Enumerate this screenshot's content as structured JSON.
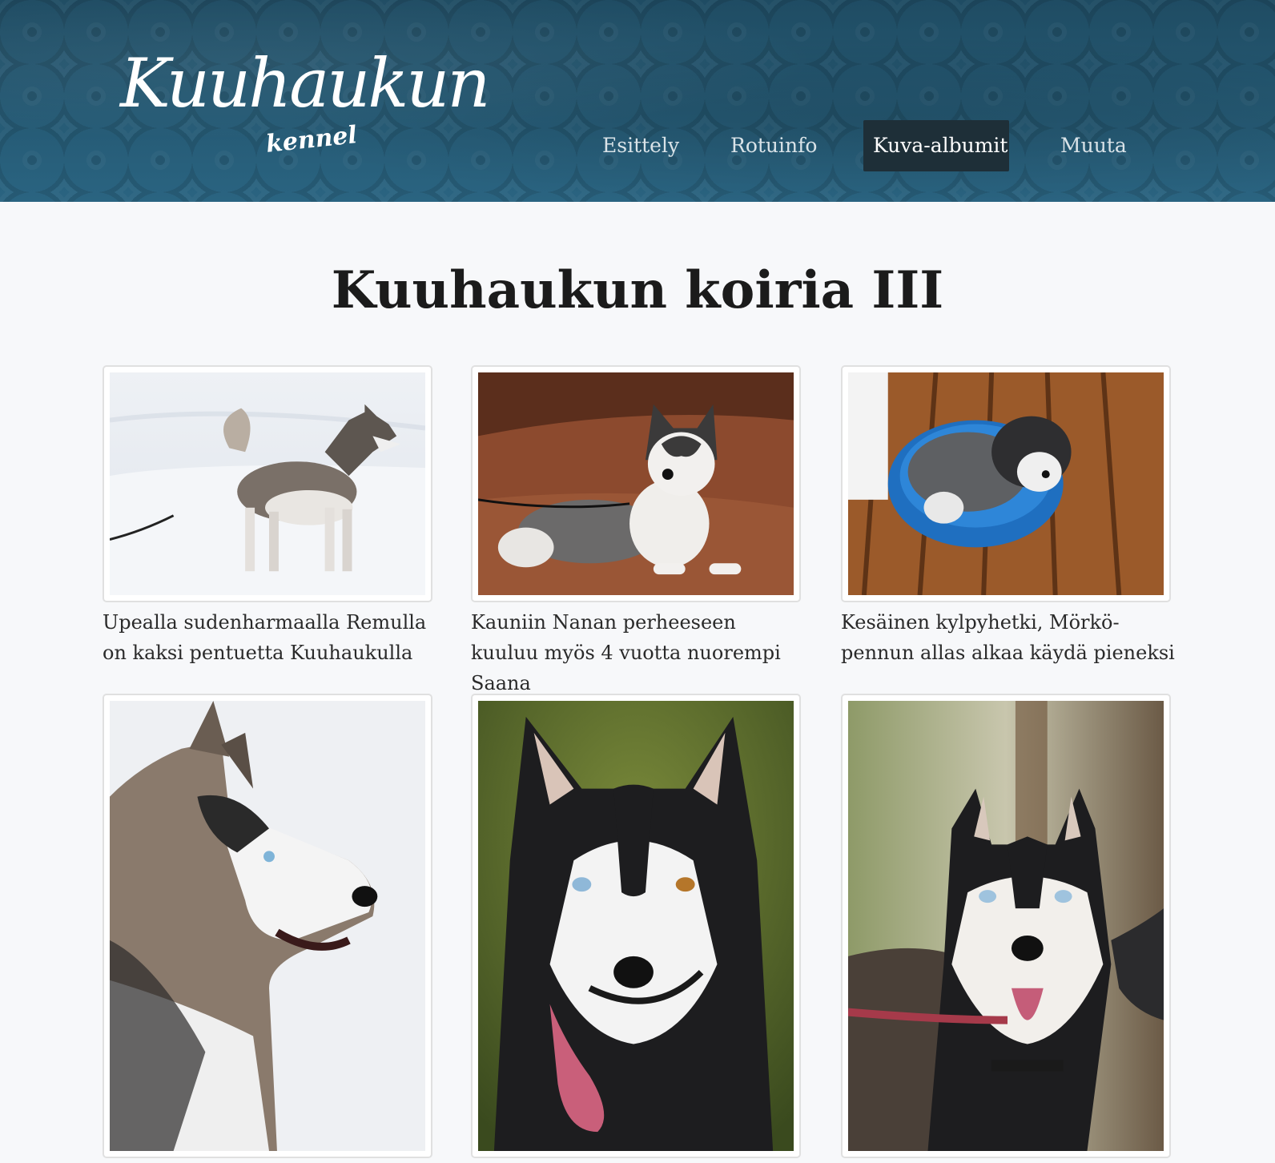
{
  "brand": {
    "logo_main": "Kuuhaukun",
    "logo_sub": "kennel"
  },
  "nav": {
    "items": [
      {
        "label": "Esittely",
        "active": false
      },
      {
        "label": "Rotuinfo",
        "active": false
      },
      {
        "label": "Kuva-albumit",
        "active": true
      },
      {
        "label": "Muuta",
        "active": false
      }
    ]
  },
  "album": {
    "title": "Kuuhaukun koiria III",
    "photos": [
      {
        "caption": "Upealla sudenharmaalla Remulla on kaksi pentuetta Kuuhaukulla",
        "subject": "husky-standing-in-snow"
      },
      {
        "caption": "Kauniin Nanan perheeseen kuuluu myös 4 vuotta nuorempi Saana",
        "subject": "husky-lying-on-forest-floor"
      },
      {
        "caption": "Kesäinen kylpyhetki, Mörkö-pennun allas alkaa käydä pieneksi",
        "subject": "puppy-in-blue-tub"
      },
      {
        "caption": "",
        "subject": "husky-profile-portrait"
      },
      {
        "caption": "",
        "subject": "husky-portrait-tongue-out"
      },
      {
        "caption": "",
        "subject": "husky-in-harness-portrait"
      }
    ]
  },
  "colors": {
    "header_bg": "#24566f",
    "nav_active_bg": "#1e2f38",
    "page_bg": "#f7f8fa"
  }
}
